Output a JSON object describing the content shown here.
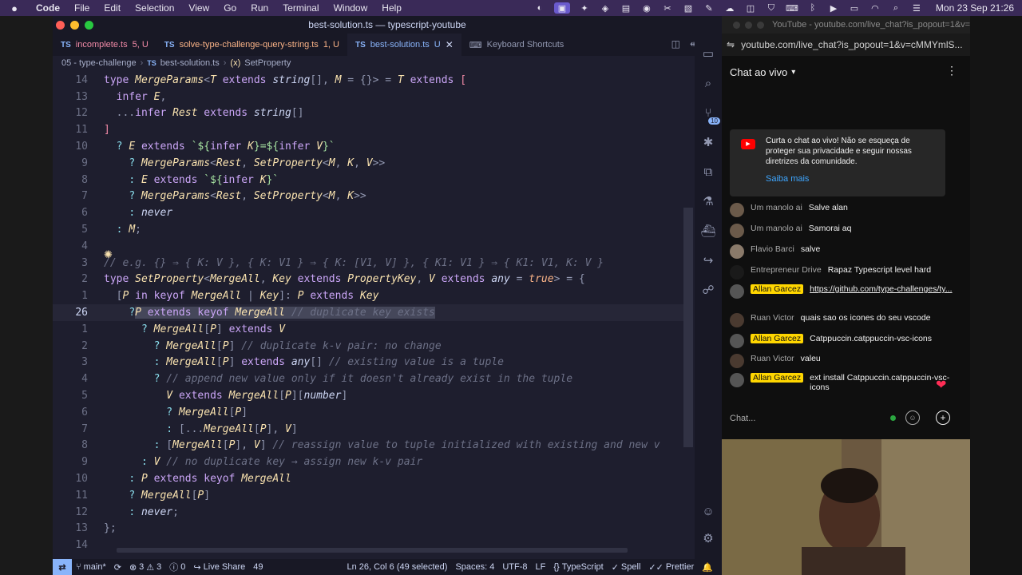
{
  "menubar": {
    "app": "Code",
    "items": [
      "File",
      "Edit",
      "Selection",
      "View",
      "Go",
      "Run",
      "Terminal",
      "Window",
      "Help"
    ],
    "clock": "Mon 23 Sep  21:26"
  },
  "window": {
    "title": "best-solution.ts — typescript-youtube"
  },
  "tabs": [
    {
      "label": "incomplete.ts",
      "status": "5, U"
    },
    {
      "label": "solve-type-challenge-query-string.ts",
      "status": "1, U"
    },
    {
      "label": "best-solution.ts",
      "status": "U"
    },
    {
      "label": "Keyboard Shortcuts",
      "status": ""
    }
  ],
  "breadcrumb": {
    "folder": "05 - type-challenge",
    "file": "best-solution.ts",
    "symbol": "SetProperty"
  },
  "editor": {
    "lines": [
      {
        "n": "14",
        "segs": [
          [
            "kw",
            "type "
          ],
          [
            "ty",
            "MergeParams"
          ],
          [
            "pu",
            "<"
          ],
          [
            "ty",
            "T "
          ],
          [
            "kw",
            "extends "
          ],
          [
            "tx",
            "string"
          ],
          [
            "pu",
            "[], "
          ],
          [
            "ty",
            "M "
          ],
          [
            "pu",
            "= {}> = "
          ],
          [
            "ty",
            "T "
          ],
          [
            "kw",
            "extends "
          ],
          [
            "bk",
            "["
          ]
        ]
      },
      {
        "n": "13",
        "segs": [
          [
            "tx",
            "  "
          ],
          [
            "kw",
            "infer "
          ],
          [
            "ty",
            "E"
          ],
          [
            "pu",
            ","
          ]
        ]
      },
      {
        "n": "12",
        "segs": [
          [
            "tx",
            "  "
          ],
          [
            "pu",
            "..."
          ],
          [
            "kw",
            "infer "
          ],
          [
            "ty",
            "Rest "
          ],
          [
            "kw",
            "extends "
          ],
          [
            "tx",
            "string"
          ],
          [
            "pu",
            "[]"
          ]
        ]
      },
      {
        "n": "11",
        "segs": [
          [
            "bk",
            "]"
          ]
        ]
      },
      {
        "n": "10",
        "segs": [
          [
            "tx",
            "  "
          ],
          [
            "op",
            "? "
          ],
          [
            "ty",
            "E "
          ],
          [
            "kw",
            "extends "
          ],
          [
            "st",
            "`${"
          ],
          [
            "kw",
            "infer "
          ],
          [
            "ty",
            "K"
          ],
          [
            "st",
            "}=${"
          ],
          [
            "kw",
            "infer "
          ],
          [
            "ty",
            "V"
          ],
          [
            "st",
            "}`"
          ]
        ]
      },
      {
        "n": "9",
        "segs": [
          [
            "tx",
            "    "
          ],
          [
            "op",
            "? "
          ],
          [
            "ty",
            "MergeParams"
          ],
          [
            "pu",
            "<"
          ],
          [
            "ty",
            "Rest"
          ],
          [
            "pu",
            ", "
          ],
          [
            "ty",
            "SetProperty"
          ],
          [
            "pu",
            "<"
          ],
          [
            "ty",
            "M"
          ],
          [
            "pu",
            ", "
          ],
          [
            "ty",
            "K"
          ],
          [
            "pu",
            ", "
          ],
          [
            "ty",
            "V"
          ],
          [
            "pu",
            ">>"
          ]
        ]
      },
      {
        "n": "8",
        "segs": [
          [
            "tx",
            "    "
          ],
          [
            "op",
            ": "
          ],
          [
            "ty",
            "E "
          ],
          [
            "kw",
            "extends "
          ],
          [
            "st",
            "`${"
          ],
          [
            "kw",
            "infer "
          ],
          [
            "ty",
            "K"
          ],
          [
            "st",
            "}`"
          ]
        ]
      },
      {
        "n": "7",
        "segs": [
          [
            "tx",
            "    "
          ],
          [
            "op",
            "? "
          ],
          [
            "ty",
            "MergeParams"
          ],
          [
            "pu",
            "<"
          ],
          [
            "ty",
            "Rest"
          ],
          [
            "pu",
            ", "
          ],
          [
            "ty",
            "SetProperty"
          ],
          [
            "pu",
            "<"
          ],
          [
            "ty",
            "M"
          ],
          [
            "pu",
            ", "
          ],
          [
            "ty",
            "K"
          ],
          [
            "pu",
            ">>"
          ]
        ]
      },
      {
        "n": "6",
        "segs": [
          [
            "tx",
            "    "
          ],
          [
            "op",
            ": "
          ],
          [
            "tx",
            "never"
          ]
        ]
      },
      {
        "n": "5",
        "segs": [
          [
            "tx",
            "  "
          ],
          [
            "op",
            ": "
          ],
          [
            "ty",
            "M"
          ],
          [
            "pu",
            ";"
          ]
        ]
      },
      {
        "n": "4",
        "segs": []
      },
      {
        "n": "3",
        "segs": [
          [
            "cm",
            "// e.g. {} ⇒ { K: V }, { K: V1 } ⇒ { K: [V1, V] }, { K1: V1 } ⇒ { K1: V1, K: V }"
          ]
        ]
      },
      {
        "n": "2",
        "segs": [
          [
            "kw",
            "type "
          ],
          [
            "ty",
            "SetProperty"
          ],
          [
            "pu",
            "<"
          ],
          [
            "ty",
            "MergeAll"
          ],
          [
            "pu",
            ", "
          ],
          [
            "ty",
            "Key "
          ],
          [
            "kw",
            "extends "
          ],
          [
            "ty",
            "PropertyKey"
          ],
          [
            "pu",
            ", "
          ],
          [
            "ty",
            "V "
          ],
          [
            "kw",
            "extends "
          ],
          [
            "tx",
            "any "
          ],
          [
            "pu",
            "= "
          ],
          [
            "or",
            "true"
          ],
          [
            "pu",
            "> = {"
          ]
        ]
      },
      {
        "n": "1",
        "segs": [
          [
            "tx",
            "  "
          ],
          [
            "pu",
            "["
          ],
          [
            "ty",
            "P "
          ],
          [
            "kw",
            "in keyof "
          ],
          [
            "ty",
            "MergeAll "
          ],
          [
            "pu",
            "| "
          ],
          [
            "ty",
            "Key"
          ],
          [
            "pu",
            "]: "
          ],
          [
            "ty",
            "P "
          ],
          [
            "kw",
            "extends "
          ],
          [
            "ty",
            "Key"
          ]
        ]
      },
      {
        "n": "26",
        "current": true,
        "segs": [
          [
            "tx",
            "    "
          ],
          [
            "op",
            "?"
          ],
          [
            "sel-ty",
            "P "
          ],
          [
            "sel-kw",
            "extends keyof "
          ],
          [
            "sel-ty",
            "MergeAll "
          ],
          [
            "sel-cm",
            "// duplicate key exists"
          ]
        ]
      },
      {
        "n": "1",
        "segs": [
          [
            "tx",
            "      "
          ],
          [
            "op",
            "? "
          ],
          [
            "ty",
            "MergeAll"
          ],
          [
            "pu",
            "["
          ],
          [
            "ty",
            "P"
          ],
          [
            "pu",
            "] "
          ],
          [
            "kw",
            "extends "
          ],
          [
            "ty",
            "V"
          ]
        ]
      },
      {
        "n": "2",
        "segs": [
          [
            "tx",
            "        "
          ],
          [
            "op",
            "? "
          ],
          [
            "ty",
            "MergeAll"
          ],
          [
            "pu",
            "["
          ],
          [
            "ty",
            "P"
          ],
          [
            "pu",
            "] "
          ],
          [
            "cm",
            "// duplicate k-v pair: no change"
          ]
        ]
      },
      {
        "n": "3",
        "segs": [
          [
            "tx",
            "        "
          ],
          [
            "op",
            ": "
          ],
          [
            "ty",
            "MergeAll"
          ],
          [
            "pu",
            "["
          ],
          [
            "ty",
            "P"
          ],
          [
            "pu",
            "] "
          ],
          [
            "kw",
            "extends "
          ],
          [
            "tx",
            "any"
          ],
          [
            "pu",
            "[] "
          ],
          [
            "cm",
            "// existing value is a tuple"
          ]
        ]
      },
      {
        "n": "4",
        "segs": [
          [
            "tx",
            "        "
          ],
          [
            "op",
            "? "
          ],
          [
            "cm",
            "// append new value only if it doesn't already exist in the tuple"
          ]
        ]
      },
      {
        "n": "5",
        "segs": [
          [
            "tx",
            "          "
          ],
          [
            "ty",
            "V "
          ],
          [
            "kw",
            "extends "
          ],
          [
            "ty",
            "MergeAll"
          ],
          [
            "pu",
            "["
          ],
          [
            "ty",
            "P"
          ],
          [
            "pu",
            "]["
          ],
          [
            "tx",
            "number"
          ],
          [
            "pu",
            "]"
          ]
        ]
      },
      {
        "n": "6",
        "segs": [
          [
            "tx",
            "          "
          ],
          [
            "op",
            "? "
          ],
          [
            "ty",
            "MergeAll"
          ],
          [
            "pu",
            "["
          ],
          [
            "ty",
            "P"
          ],
          [
            "pu",
            "]"
          ]
        ]
      },
      {
        "n": "7",
        "segs": [
          [
            "tx",
            "          "
          ],
          [
            "op",
            ": "
          ],
          [
            "pu",
            "[..."
          ],
          [
            "ty",
            "MergeAll"
          ],
          [
            "pu",
            "["
          ],
          [
            "ty",
            "P"
          ],
          [
            "pu",
            "], "
          ],
          [
            "ty",
            "V"
          ],
          [
            "pu",
            "]"
          ]
        ]
      },
      {
        "n": "8",
        "segs": [
          [
            "tx",
            "        "
          ],
          [
            "op",
            ": "
          ],
          [
            "pu",
            "["
          ],
          [
            "ty",
            "MergeAll"
          ],
          [
            "pu",
            "["
          ],
          [
            "ty",
            "P"
          ],
          [
            "pu",
            "], "
          ],
          [
            "ty",
            "V"
          ],
          [
            "pu",
            "] "
          ],
          [
            "cm",
            "// reassign value to tuple initialized with existing and new v"
          ]
        ]
      },
      {
        "n": "9",
        "segs": [
          [
            "tx",
            "      "
          ],
          [
            "op",
            ": "
          ],
          [
            "ty",
            "V "
          ],
          [
            "cm",
            "// no duplicate key → assign new k-v pair"
          ]
        ]
      },
      {
        "n": "10",
        "segs": [
          [
            "tx",
            "    "
          ],
          [
            "op",
            ": "
          ],
          [
            "ty",
            "P "
          ],
          [
            "kw",
            "extends keyof "
          ],
          [
            "ty",
            "MergeAll"
          ]
        ]
      },
      {
        "n": "11",
        "segs": [
          [
            "tx",
            "    "
          ],
          [
            "op",
            "? "
          ],
          [
            "ty",
            "MergeAll"
          ],
          [
            "pu",
            "["
          ],
          [
            "ty",
            "P"
          ],
          [
            "pu",
            "]"
          ]
        ]
      },
      {
        "n": "12",
        "segs": [
          [
            "tx",
            "    "
          ],
          [
            "op",
            ": "
          ],
          [
            "tx",
            "never"
          ],
          [
            "pu",
            ";"
          ]
        ]
      },
      {
        "n": "13",
        "segs": [
          [
            "pu",
            "};"
          ]
        ]
      },
      {
        "n": "14",
        "segs": []
      }
    ]
  },
  "activity": {
    "source_control_badge": "10"
  },
  "statusbar": {
    "branch": "main*",
    "errors": "3",
    "warnings": "3",
    "info": "0",
    "liveshare": "Live Share",
    "count": "49",
    "position": "Ln 26, Col 6 (49 selected)",
    "spaces": "Spaces: 4",
    "encoding": "UTF-8",
    "eol": "LF",
    "language": "TypeScript",
    "spell": "Spell",
    "prettier": "Prettier"
  },
  "chat": {
    "window_title": "YouTube - youtube.com/live_chat?is_popout=1&v=cMMYmlS...",
    "url": "youtube.com/live_chat?is_popout=1&v=cMMYmlS...",
    "header": "Chat ao vivo",
    "notice": "Curta o chat ao vivo! Não se esqueça de proteger sua privacidade e seguir nossas diretrizes da comunidade.",
    "notice_link": "Saiba mais",
    "messages": [
      {
        "author": "Um manolo ai",
        "text": "Salve alan",
        "owner": false
      },
      {
        "author": "Um manolo ai",
        "text": "Samorai aq",
        "owner": false
      },
      {
        "author": "Flavio Barci",
        "text": "salve",
        "owner": false
      },
      {
        "author": "Entrepreneur Drive",
        "text": "Rapaz Typescript level hard",
        "owner": false
      },
      {
        "author": "Allan Garcez",
        "text": "https://github.com/type-challenges/ty...",
        "owner": true,
        "link": true
      },
      {
        "author": "Ruan Victor",
        "text": "quais sao os icones do seu vscode",
        "owner": false
      },
      {
        "author": "Allan Garcez",
        "text": "Catppuccin.catppuccin-vsc-icons",
        "owner": true
      },
      {
        "author": "Ruan Victor",
        "text": "valeu",
        "owner": false
      },
      {
        "author": "Allan Garcez",
        "text": "ext install Catppuccin.catppuccin-vsc-icons",
        "owner": true
      }
    ],
    "input_placeholder": "Chat..."
  },
  "colors": {
    "accent": "#89b4fa",
    "editor_bg": "#1e1e2e",
    "chat_bg": "#0f0f0f",
    "owner_badge": "#ffd600"
  }
}
